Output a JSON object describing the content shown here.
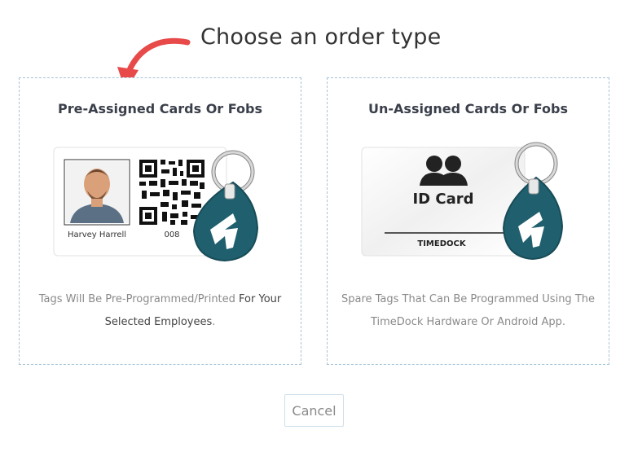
{
  "page": {
    "heading": "Choose an order type",
    "cancel_label": "Cancel"
  },
  "options": [
    {
      "title": "Pre-Assigned Cards Or Fobs",
      "card_name": "Harvey Harrell",
      "card_number": "008",
      "desc_light_1": "Tags Will Be Pre-Programmed/Printed ",
      "desc_dark_1": "For Your",
      "desc_dark_2": "Selected Employees",
      "desc_light_2": "."
    },
    {
      "title": "Un-Assigned Cards Or Fobs",
      "card_label": "ID Card",
      "card_brand": "TIMEDOCK",
      "desc_line_1": "Spare Tags That Can Be Programmed Using The",
      "desc_line_2": "TimeDock Hardware Or Android App."
    }
  ],
  "colors": {
    "arrow": "#e84a4a",
    "fob": "#1f5f6e",
    "border": "#a9c3d6"
  },
  "icons": [
    "curved-arrow-icon",
    "employee-photo",
    "qr-code-icon",
    "key-fob-icon",
    "people-icon",
    "timedock-logo"
  ]
}
